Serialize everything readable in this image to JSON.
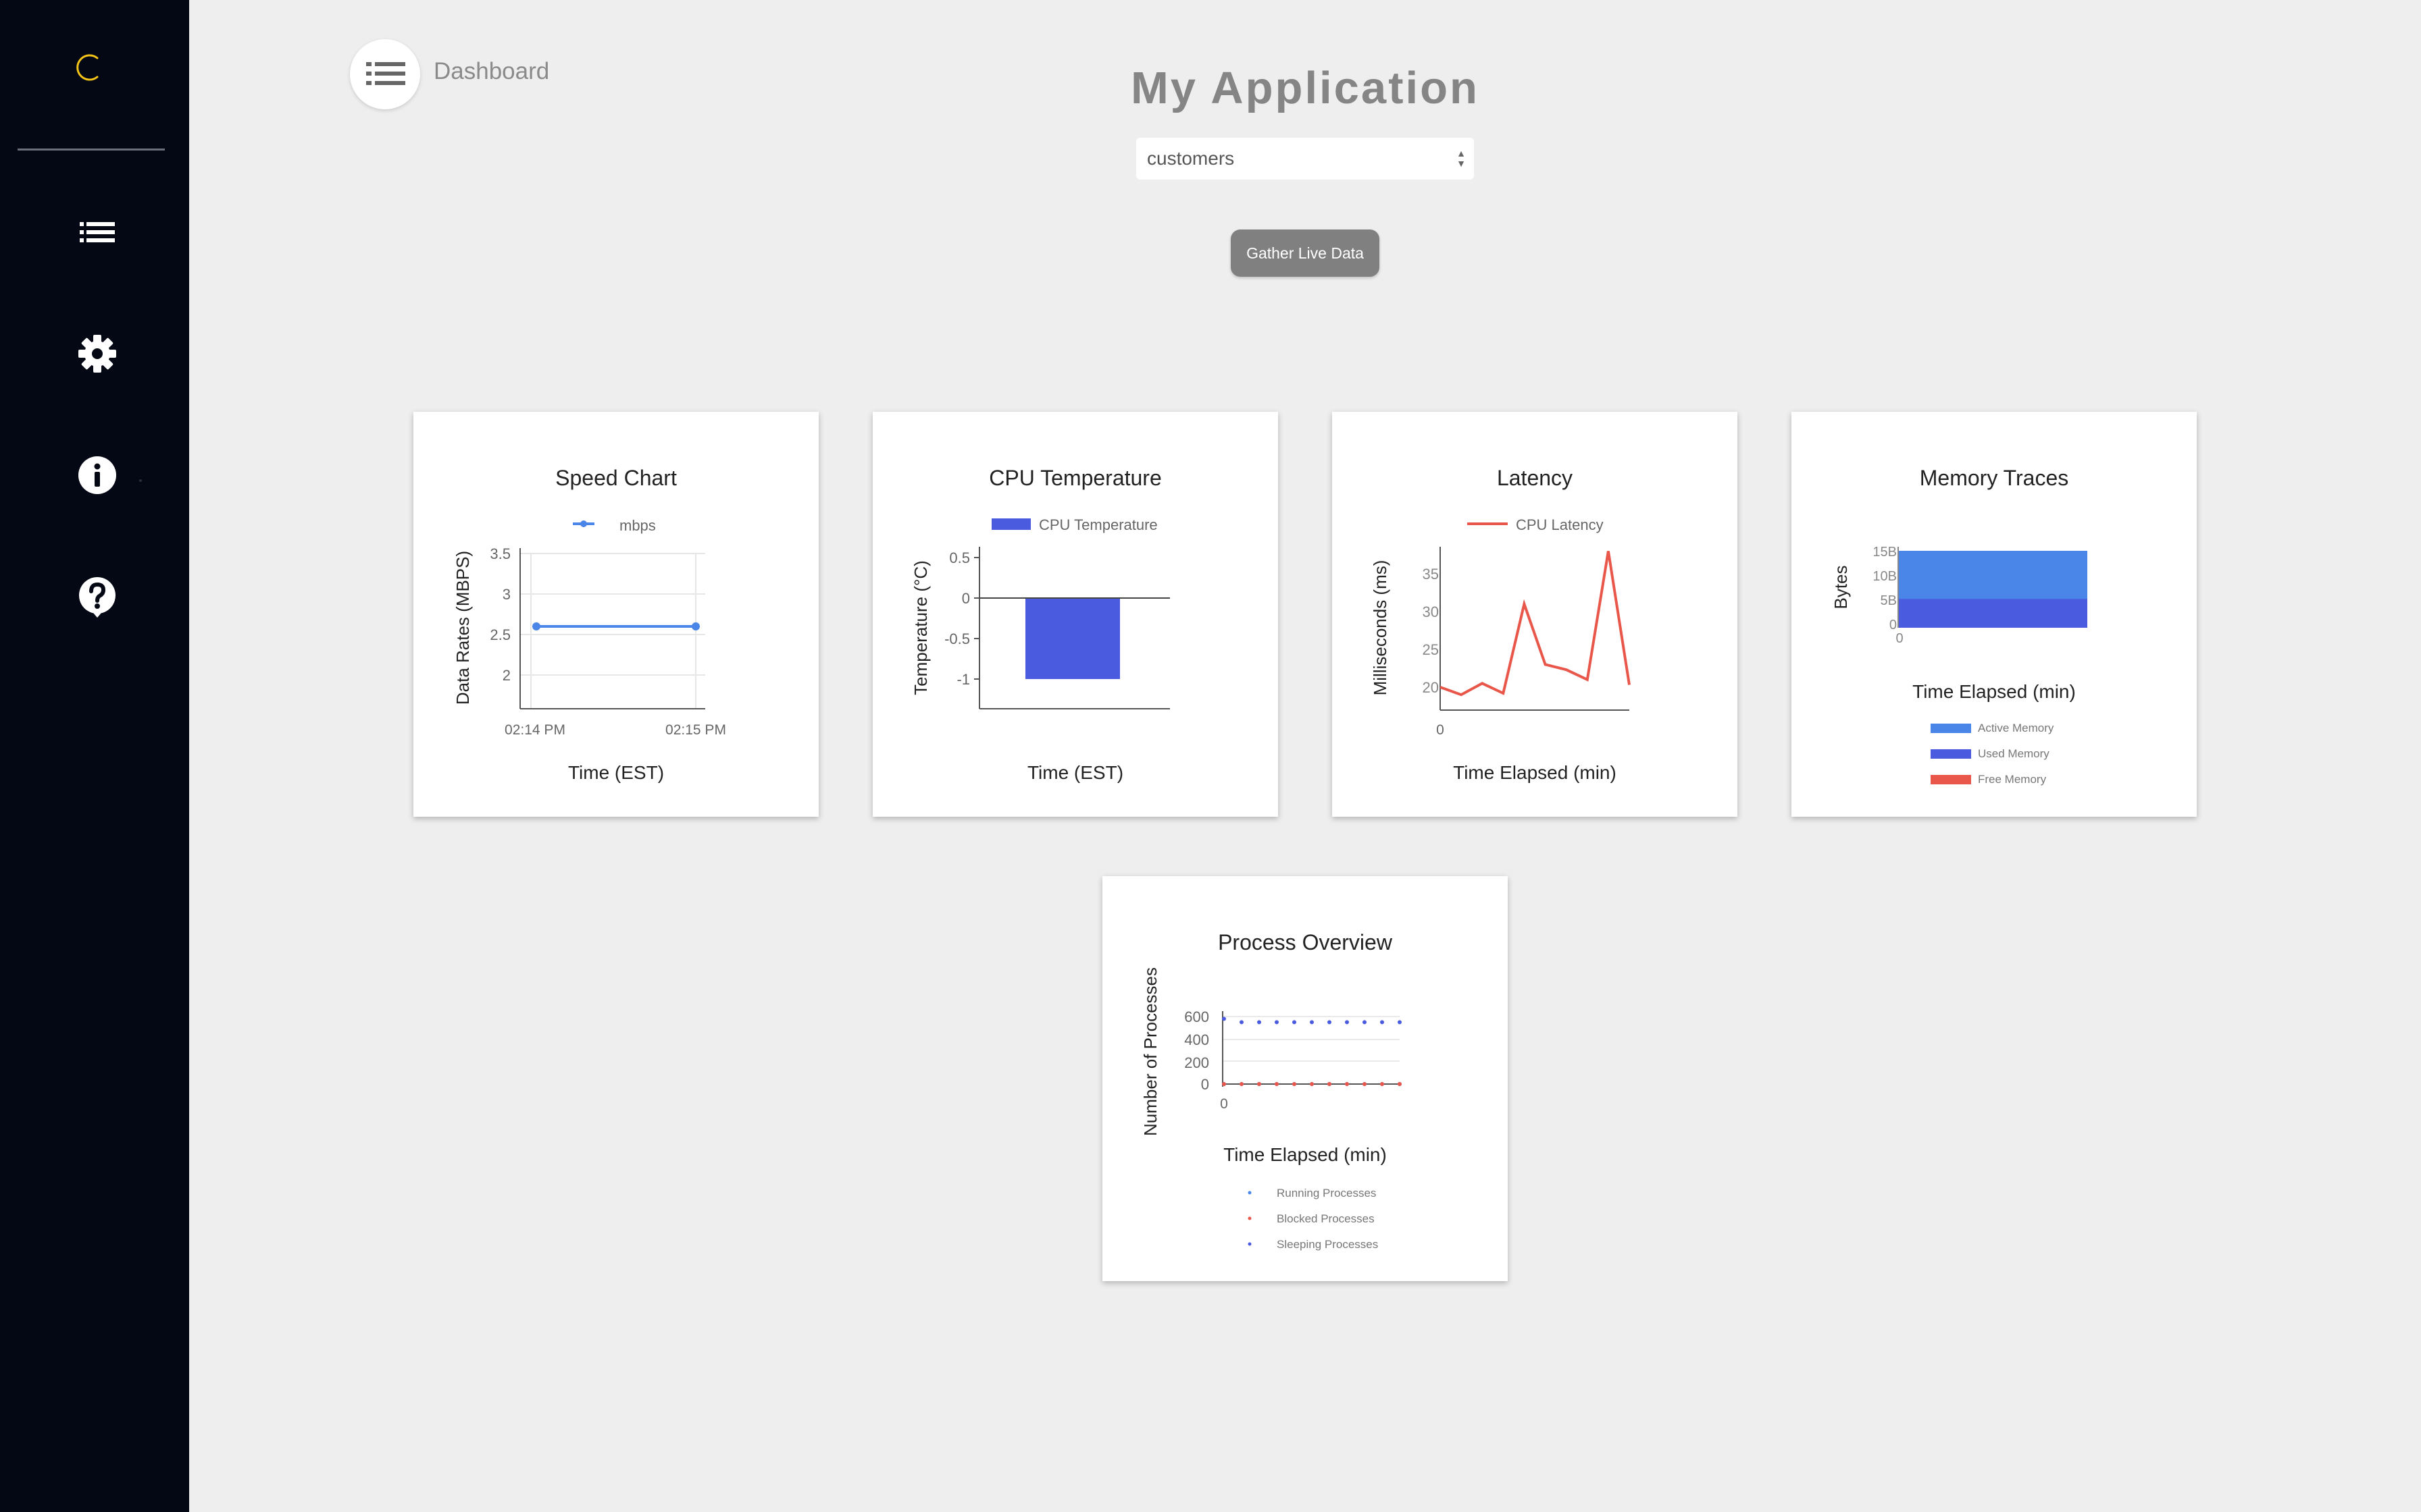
{
  "sidebar": {
    "items": [
      {
        "icon": "list-icon"
      },
      {
        "icon": "gear-icon"
      },
      {
        "icon": "info-icon"
      },
      {
        "icon": "help-icon"
      }
    ],
    "accent": "#f5c518"
  },
  "header": {
    "breadcrumb": "Dashboard",
    "title": "My Application",
    "select": {
      "value": "customers",
      "arrow_up": "▲",
      "arrow_down": "▼"
    },
    "gather_button": "Gather Live Data"
  },
  "cards": {
    "speed": {
      "title": "Speed Chart",
      "legend": "mbps",
      "ylabel": "Data Rates (MBPS)",
      "xlabel": "Time (EST)",
      "yticks": [
        "3.5",
        "3",
        "2.5",
        "2"
      ],
      "xticks": [
        "02:14 PM",
        "02:15 PM"
      ]
    },
    "cpu": {
      "title": "CPU Temperature",
      "legend": "CPU Temperature",
      "ylabel": "Temperature (°C)",
      "xlabel": "Time (EST)",
      "yticks": [
        "0.5",
        "0",
        "-0.5",
        "-1"
      ]
    },
    "latency": {
      "title": "Latency",
      "legend": "CPU Latency",
      "ylabel": "Milliseconds (ms)",
      "xlabel": "Time Elapsed (min)",
      "yticks": [
        "35",
        "30",
        "25",
        "20"
      ],
      "xtick": "0"
    },
    "memory": {
      "title": "Memory Traces",
      "ylabel": "Bytes",
      "xlabel": "Time Elapsed (min)",
      "yticks": [
        "15B",
        "10B",
        "5B",
        "0"
      ],
      "xtick": "0",
      "legend": [
        "Active Memory",
        "Used Memory",
        "Free Memory"
      ]
    },
    "process": {
      "title": "Process Overview",
      "ylabel": "Number of Processes",
      "xlabel": "Time Elapsed (min)",
      "yticks": [
        "600",
        "400",
        "200",
        "0"
      ],
      "xtick": "0",
      "legend": [
        "Running Processes",
        "Blocked Processes",
        "Sleeping Processes"
      ]
    }
  },
  "chart_data": [
    {
      "type": "line",
      "title": "Speed Chart",
      "xlabel": "Time (EST)",
      "ylabel": "Data Rates (MBPS)",
      "x": [
        "02:14 PM",
        "02:15 PM"
      ],
      "series": [
        {
          "name": "mbps",
          "values": [
            2.6,
            2.6
          ],
          "color": "#4a86e8"
        }
      ],
      "ylim": [
        1.8,
        3.5
      ]
    },
    {
      "type": "bar",
      "title": "CPU Temperature",
      "xlabel": "Time (EST)",
      "ylabel": "Temperature (°C)",
      "categories": [
        ""
      ],
      "series": [
        {
          "name": "CPU Temperature",
          "values": [
            -1
          ],
          "color": "#4a5be0"
        }
      ],
      "ylim": [
        -1.4,
        0.5
      ]
    },
    {
      "type": "line",
      "title": "Latency",
      "xlabel": "Time Elapsed (min)",
      "ylabel": "Milliseconds (ms)",
      "series": [
        {
          "name": "CPU Latency",
          "color": "#e8574a",
          "values": [
            20,
            19,
            20.5,
            19.2,
            31,
            23,
            22.3,
            21,
            38,
            20.3
          ]
        }
      ],
      "ylim": [
        17,
        37
      ]
    },
    {
      "type": "area",
      "title": "Memory Traces",
      "xlabel": "Time Elapsed (min)",
      "ylabel": "Bytes",
      "series": [
        {
          "name": "Active Memory",
          "values": [
            16,
            16
          ],
          "color": "#4a86e8"
        },
        {
          "name": "Used Memory",
          "values": [
            6,
            6
          ],
          "color": "#4a5be0"
        },
        {
          "name": "Free Memory",
          "values": [
            0,
            0
          ],
          "color": "#e8574a"
        }
      ],
      "ylim": [
        0,
        16
      ]
    },
    {
      "type": "scatter",
      "title": "Process Overview",
      "xlabel": "Time Elapsed (min)",
      "ylabel": "Number of Processes",
      "series": [
        {
          "name": "Running Processes",
          "values": [
            0,
            0,
            0,
            0,
            0,
            0,
            0,
            0,
            0,
            0,
            0
          ],
          "color": "#4a86e8"
        },
        {
          "name": "Blocked Processes",
          "values": [
            0,
            0,
            0,
            0,
            0,
            0,
            0,
            0,
            0,
            0,
            0
          ],
          "color": "#e8574a"
        },
        {
          "name": "Sleeping Processes",
          "values": [
            580,
            550,
            550,
            550,
            550,
            550,
            550,
            550,
            550,
            550,
            550
          ],
          "color": "#4a5be0"
        }
      ],
      "ylim": [
        0,
        650
      ]
    }
  ]
}
